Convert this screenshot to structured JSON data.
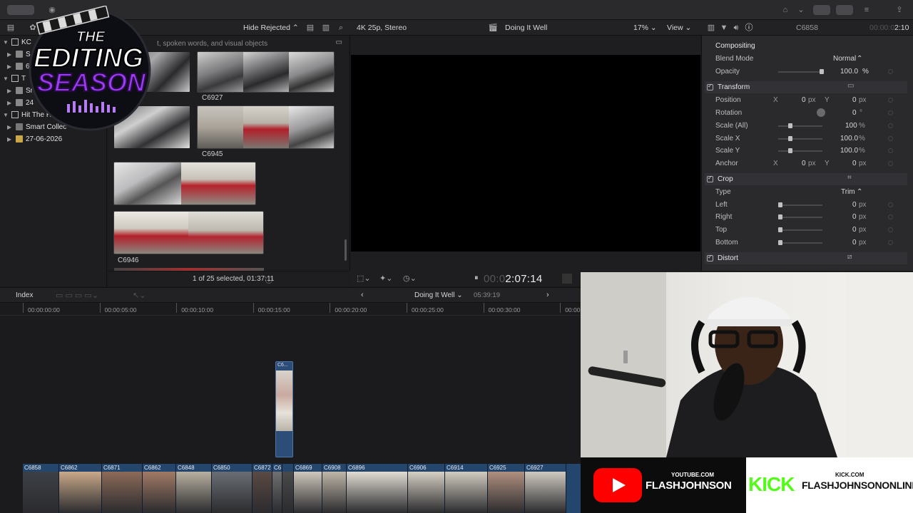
{
  "topbar": {},
  "browser": {
    "filter_label": "Hide Rejected",
    "search_placeholder": "t, spoken words, and visual objects",
    "clips": [
      {
        "name": "C6927"
      },
      {
        "name": "C6945"
      },
      {
        "name": "C6946"
      }
    ],
    "status": "1 of 25 selected, 01:37:11"
  },
  "sidebar": {
    "items": [
      {
        "label": "KC"
      },
      {
        "label": "S"
      },
      {
        "label": "6"
      },
      {
        "label": "T"
      },
      {
        "label": "Sn"
      },
      {
        "label": "24"
      },
      {
        "label": "Hit The R"
      },
      {
        "label": "Smart Collec"
      },
      {
        "label": "27-06-2026"
      }
    ]
  },
  "viewer": {
    "format": "4K 25p, Stereo",
    "project_name": "Doing It Well",
    "zoom": "17%",
    "view_label": "View",
    "timecode_dim": "00:0",
    "timecode_main": "2:07:14"
  },
  "inspector": {
    "clip_name": "C6858",
    "duration_dim": "00:00:0",
    "duration": "2:10",
    "compositing": {
      "title": "Compositing",
      "blend_mode_label": "Blend Mode",
      "blend_mode_value": "Normal",
      "opacity_label": "Opacity",
      "opacity_value": "100.0",
      "opacity_unit": "%"
    },
    "transform": {
      "title": "Transform",
      "position_label": "Position",
      "position_x": "0",
      "position_y": "0",
      "rotation_label": "Rotation",
      "rotation_value": "0",
      "rotation_unit": "°",
      "scale_all_label": "Scale (All)",
      "scale_all_value": "100",
      "scale_x_label": "Scale X",
      "scale_x_value": "100.0",
      "scale_y_label": "Scale Y",
      "scale_y_value": "100.0",
      "anchor_label": "Anchor",
      "anchor_x": "0",
      "anchor_y": "0",
      "px": "px",
      "pct": "%",
      "x_axis": "X",
      "y_axis": "Y"
    },
    "crop": {
      "title": "Crop",
      "type_label": "Type",
      "type_value": "Trim",
      "left_label": "Left",
      "right_label": "Right",
      "top_label": "Top",
      "bottom_label": "Bottom",
      "value": "0",
      "px": "px"
    },
    "distort": {
      "title": "Distort"
    }
  },
  "timeline": {
    "index_label": "Index",
    "project_name": "Doing It Well",
    "duration": "05:39:19",
    "ruler": [
      "00:00:00:00",
      "00:00:05:00",
      "00:00:10:00",
      "00:00:15:00",
      "00:00:20:00",
      "00:00:25:00",
      "00:00:30:00",
      "00:00"
    ],
    "connected_clip_name": "C6...",
    "storyline": [
      "C6858",
      "C6862",
      "C6871",
      "C6862",
      "C6848",
      "C6850",
      "C6872",
      "C6...",
      "",
      "C6869",
      "C6908",
      "C6896",
      "C6906",
      "C6914",
      "C6925",
      "C6927"
    ]
  },
  "overlay": {
    "logo_line1": "THE",
    "logo_line2": "EDITING",
    "logo_line3": "SEASON",
    "youtube_site": "YOUTUBE.COM",
    "youtube_handle": "FLASHJOHNSON",
    "kick_logo": "KICK",
    "kick_site": "KICK.COM",
    "kick_handle": "FLASHJOHNSONONLINE",
    "colors": {
      "youtube_red": "#ff0000",
      "kick_green": "#53fc18",
      "logo_purple": "#9b3cf0"
    }
  }
}
